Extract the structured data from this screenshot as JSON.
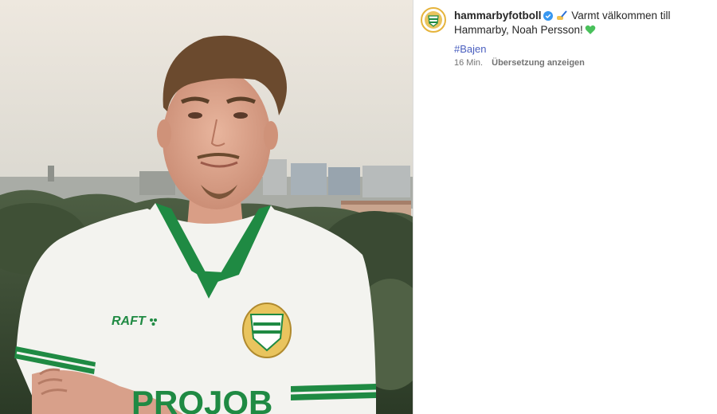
{
  "post": {
    "username": "hammarbyfotboll",
    "caption_text": "Varmt välkommen till Hammarby, Noah Persson!",
    "hashtag": "#Bajen",
    "time": "16 Min.",
    "translate_label": "Übersetzung anzeigen"
  },
  "photo": {
    "jersey_brand": "RAFT",
    "jersey_sponsor": "PROJOB"
  },
  "colors": {
    "brand_green": "#1f8a43",
    "verified_blue": "#3897f0",
    "hashtag_blue": "#4a5fbf",
    "meta_gray": "#737373"
  },
  "icons": [
    "verified-badge-icon",
    "writing-hand-emoji",
    "green-heart-emoji",
    "club-crest-icon"
  ]
}
